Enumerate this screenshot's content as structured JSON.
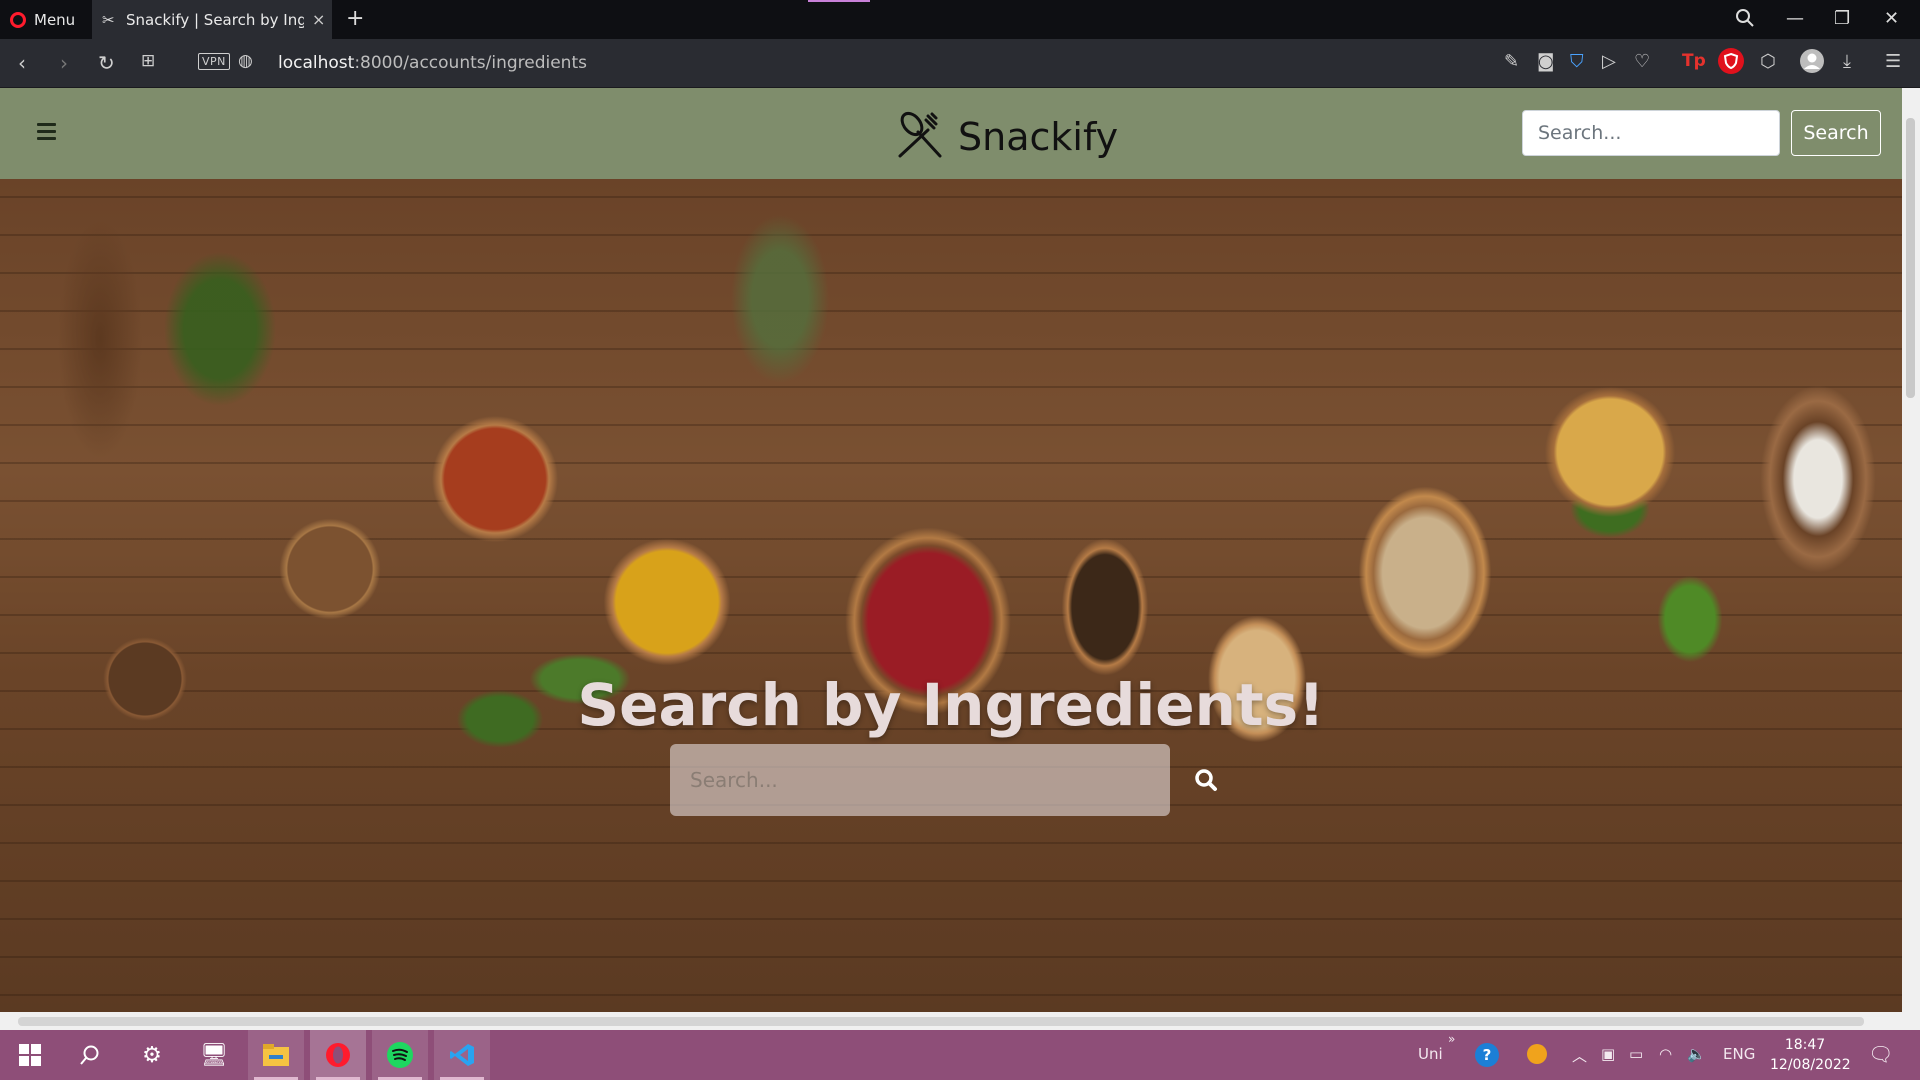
{
  "browser": {
    "menu_label": "Menu",
    "tab": {
      "title": "Snackify | Search by Ingredients",
      "close_icon": "×"
    },
    "new_tab_icon": "+",
    "window_controls": {
      "minimize": "—",
      "restore": "❐",
      "close": "✕"
    },
    "vpn_label": "VPN",
    "url": {
      "host": "localhost",
      "path": ":8000/accounts/ingredients"
    }
  },
  "navbar": {
    "brand": "Snackify",
    "search_placeholder": "Search...",
    "search_button": "Search",
    "background": "#7f8d6c"
  },
  "hero": {
    "title": "Search by Ingredients!",
    "search_placeholder": "Search..."
  },
  "taskbar": {
    "tray_text_uni": "Uni",
    "language": "ENG",
    "time": "18:47",
    "date": "12/08/2022",
    "background": "#8e4e78"
  }
}
